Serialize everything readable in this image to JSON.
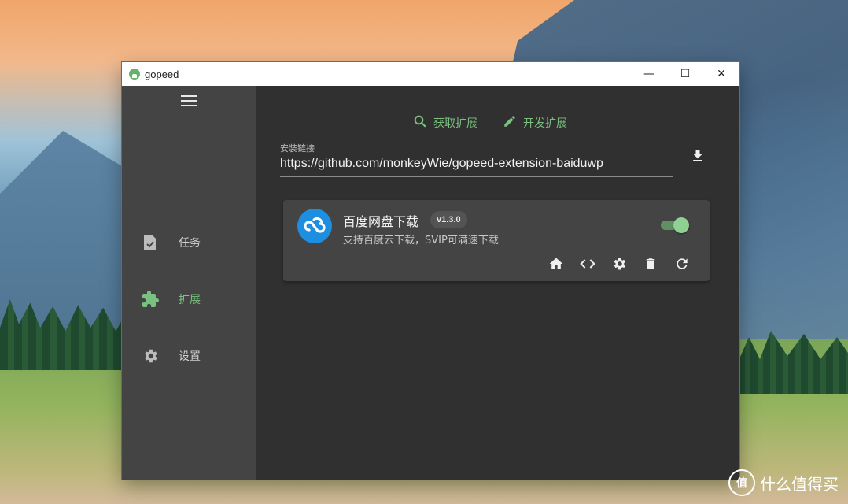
{
  "window": {
    "title": "gopeed",
    "controls": {
      "minimize": "—",
      "maximize": "☐",
      "close": "✕"
    }
  },
  "sidebar": {
    "items": [
      {
        "label": "任务",
        "icon": "task-icon",
        "active": false
      },
      {
        "label": "扩展",
        "icon": "extension-icon",
        "active": true
      },
      {
        "label": "设置",
        "icon": "settings-icon",
        "active": false
      }
    ]
  },
  "toolbar": {
    "get_extension": "获取扩展",
    "dev_extension": "开发扩展"
  },
  "install": {
    "label": "安装链接",
    "value": "https://github.com/monkeyWie/gopeed-extension-baiduwp"
  },
  "extension": {
    "title": "百度网盘下载",
    "version": "v1.3.0",
    "description": "支持百度云下载，SVIP可满速下载",
    "enabled": true
  },
  "watermark": {
    "text": "什么值得买",
    "logo": "值"
  },
  "colors": {
    "accent": "#7ac17f",
    "sidebar": "#444444",
    "main": "#303030",
    "ext_logo": "#1e8ee0"
  }
}
